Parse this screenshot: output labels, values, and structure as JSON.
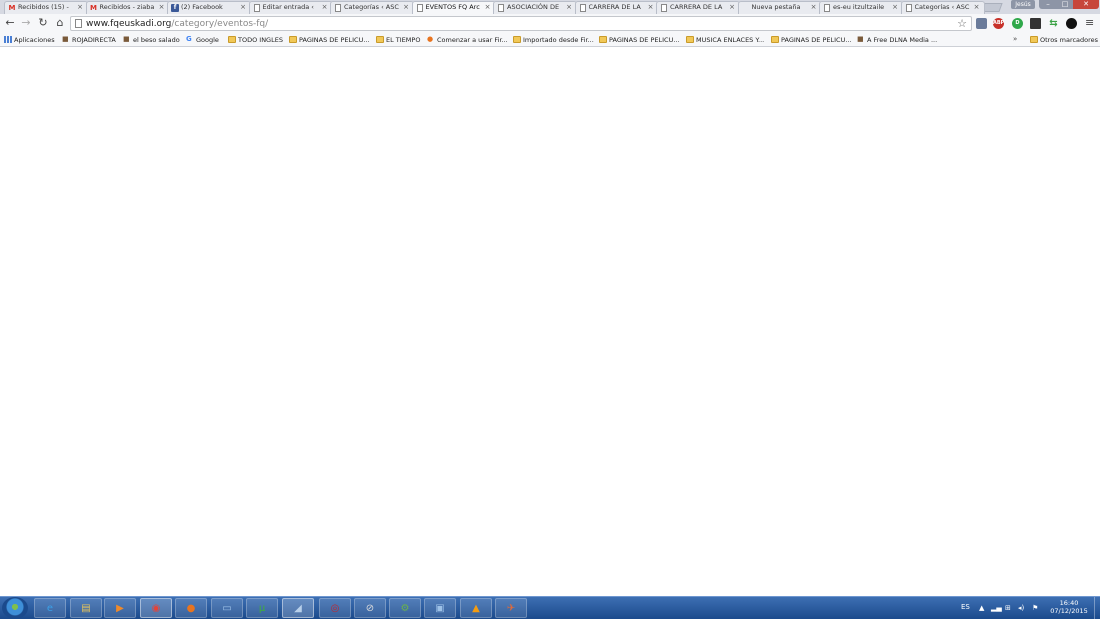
{
  "window": {
    "user_badge": "Jesús"
  },
  "tabs": [
    {
      "title": "Recibidos (15) - ",
      "icon": "gmail-icon",
      "active": false
    },
    {
      "title": "Recibidos - ziaba",
      "icon": "gmail-icon",
      "active": false
    },
    {
      "title": "(2) Facebook",
      "icon": "facebook-icon",
      "active": false
    },
    {
      "title": "Editar entrada ‹ ",
      "icon": "page-icon",
      "active": false
    },
    {
      "title": "Categorías ‹ ASC",
      "icon": "page-icon",
      "active": false
    },
    {
      "title": "EVENTOS FQ Arc",
      "icon": "page-icon",
      "active": true
    },
    {
      "title": "ASOCIACIÓN DE",
      "icon": "page-icon",
      "active": false
    },
    {
      "title": "CARRERA DE LA ",
      "icon": "page-icon",
      "active": false
    },
    {
      "title": "CARRERA DE LA ",
      "icon": "page-icon",
      "active": false
    },
    {
      "title": "Nueva pestaña",
      "icon": "none",
      "active": false
    },
    {
      "title": "es-eu itzultzaile",
      "icon": "page-icon",
      "active": false
    },
    {
      "title": "Categorías ‹ ASC",
      "icon": "page-icon",
      "active": false
    }
  ],
  "tab_close_glyph": "×",
  "address_bar": {
    "host": "www.fqeuskadi.org",
    "path": "/category/eventos-fq/"
  },
  "extensions": [
    {
      "name": "extension-icon",
      "label": ""
    },
    {
      "name": "adblock-icon",
      "label": "ABP"
    },
    {
      "name": "extension-green-icon",
      "label": "D"
    },
    {
      "name": "extension-dark-icon",
      "label": ""
    },
    {
      "name": "extension-arrows-icon",
      "label": "⇆"
    },
    {
      "name": "extension-circle-icon",
      "label": ""
    }
  ],
  "bookmarks": [
    {
      "label": "Aplicaciones",
      "icon": "apps-grid-icon"
    },
    {
      "label": "ROJADIRECTA",
      "icon": "site-icon"
    },
    {
      "label": "el beso salado",
      "icon": "site-icon"
    },
    {
      "label": "Google",
      "icon": "google-icon"
    },
    {
      "label": "TODO INGLES",
      "icon": "folder-icon"
    },
    {
      "label": "PAGINAS DE PELICU...",
      "icon": "folder-icon"
    },
    {
      "label": "EL TIEMPO",
      "icon": "folder-icon"
    },
    {
      "label": "Comenzar a usar Fir...",
      "icon": "firefox-icon"
    },
    {
      "label": "Importado desde Fir...",
      "icon": "folder-icon"
    },
    {
      "label": "PAGINAS DE PELICU...",
      "icon": "folder-icon"
    },
    {
      "label": "MUSICA ENLACES Y...",
      "icon": "folder-icon"
    },
    {
      "label": "PAGINAS DE PELICU...",
      "icon": "folder-icon"
    },
    {
      "label": "A Free DLNA Media ...",
      "icon": "site-icon"
    }
  ],
  "bookmarks_more": "»",
  "other_bookmarks": "Otros marcadores",
  "taskbar": {
    "apps": [
      {
        "name": "internet-explorer-icon",
        "glyph": "e",
        "color": "#3aa0e8"
      },
      {
        "name": "file-explorer-icon",
        "glyph": "▤",
        "color": "#e8c55a"
      },
      {
        "name": "media-player-icon",
        "glyph": "▶",
        "color": "#f08a2a"
      },
      {
        "name": "chrome-icon",
        "glyph": "◉",
        "color": "#e2443a"
      },
      {
        "name": "firefox-icon",
        "glyph": "●",
        "color": "#e8741f"
      },
      {
        "name": "window-app-icon",
        "glyph": "▭",
        "color": "#9ec2e8"
      },
      {
        "name": "utorrent-icon",
        "glyph": "µ",
        "color": "#3fae3c"
      },
      {
        "name": "file-app-icon",
        "glyph": "◢",
        "color": "#b8d0ea"
      },
      {
        "name": "app-red-icon",
        "glyph": "◎",
        "color": "#c0262d"
      },
      {
        "name": "app-disc-icon",
        "glyph": "⊘",
        "color": "#dddddd"
      },
      {
        "name": "app-network-icon",
        "glyph": "⚙",
        "color": "#69b34c"
      },
      {
        "name": "app-monitor-icon",
        "glyph": "▣",
        "color": "#9ec2e8"
      },
      {
        "name": "vlc-icon",
        "glyph": "▲",
        "color": "#f39c12"
      },
      {
        "name": "app-tools-icon",
        "glyph": "✈",
        "color": "#e06a3a"
      }
    ],
    "language": "ES",
    "clock_time": "16:40",
    "clock_date": "07/12/2015"
  }
}
